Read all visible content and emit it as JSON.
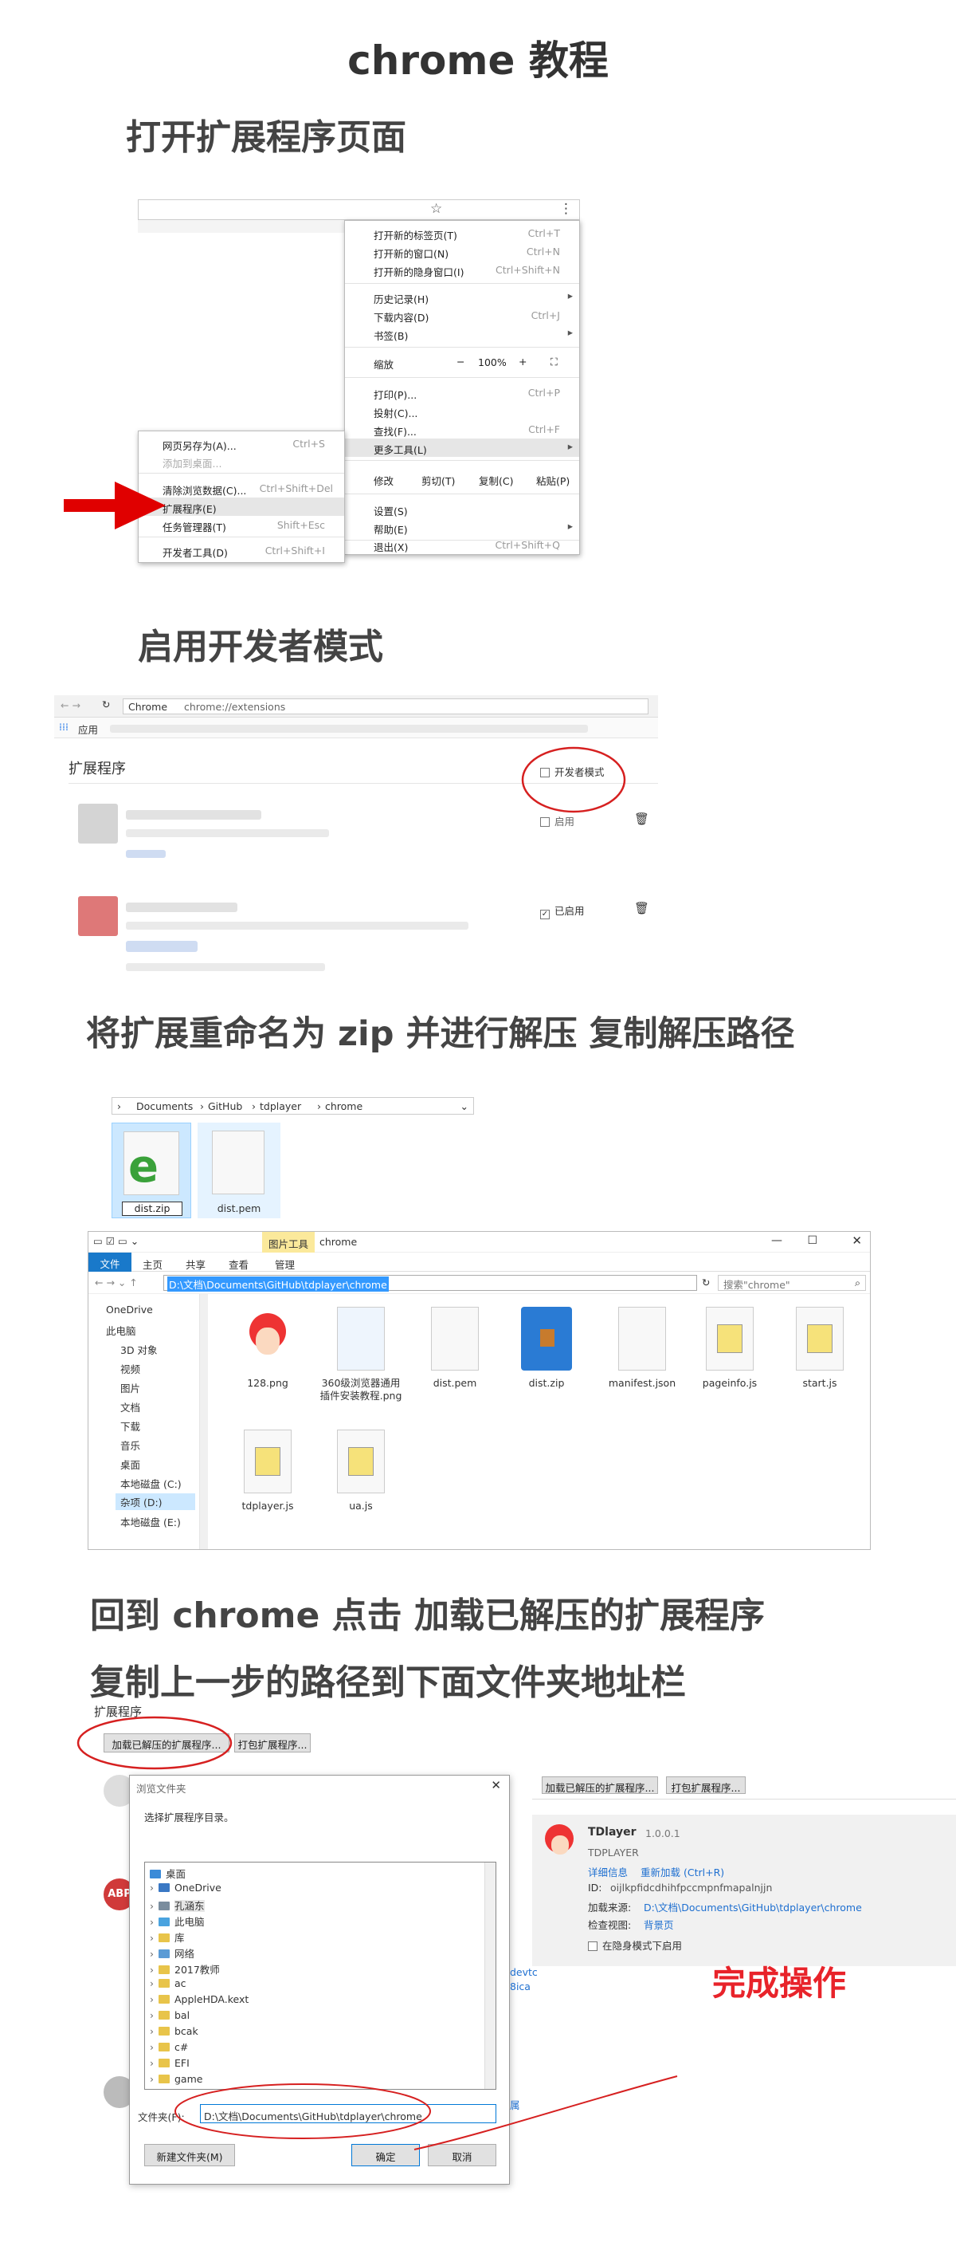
{
  "title": "chrome 教程",
  "steps": {
    "s1": "打开扩展程序页面",
    "s2": "启用开发者模式",
    "s3": "将扩展重命名为 zip 并进行解压 复制解压路径",
    "s4a": "回到 chrome 点击 加载已解压的扩展程序",
    "s4b": "复制上一步的路径到下面文件夹地址栏",
    "done": "完成操作"
  },
  "menu": {
    "items": [
      {
        "label": "打开新的标签页(T)",
        "key": "Ctrl+T"
      },
      {
        "label": "打开新的窗口(N)",
        "key": "Ctrl+N"
      },
      {
        "label": "打开新的隐身窗口(I)",
        "key": "Ctrl+Shift+N"
      },
      {
        "label": "历史记录(H)",
        "key": "▸"
      },
      {
        "label": "下载内容(D)",
        "key": "Ctrl+J"
      },
      {
        "label": "书签(B)",
        "key": "▸"
      },
      {
        "label": "打印(P)...",
        "key": "Ctrl+P"
      },
      {
        "label": "投射(C)...",
        "key": ""
      },
      {
        "label": "查找(F)...",
        "key": "Ctrl+F"
      },
      {
        "label": "更多工具(L)",
        "key": "▸"
      },
      {
        "label": "设置(S)",
        "key": ""
      },
      {
        "label": "帮助(E)",
        "key": "▸"
      },
      {
        "label": "退出(X)",
        "key": "Ctrl+Shift+Q"
      }
    ],
    "zoom": {
      "label": "缩放",
      "minus": "−",
      "value": "100%",
      "plus": "+",
      "full": "⛶"
    },
    "edit": {
      "label": "修改",
      "cut": "剪切(T)",
      "copy": "复制(C)",
      "paste": "粘贴(P)"
    },
    "sub": [
      {
        "label": "网页另存为(A)...",
        "key": "Ctrl+S"
      },
      {
        "label": "添加到桌面...",
        "key": ""
      },
      {
        "label": "清除浏览数据(C)...",
        "key": "Ctrl+Shift+Del"
      },
      {
        "label": "扩展程序(E)",
        "key": ""
      },
      {
        "label": "任务管理器(T)",
        "key": "Shift+Esc"
      },
      {
        "label": "开发者工具(D)",
        "key": "Ctrl+Shift+I"
      }
    ]
  },
  "ext": {
    "site": "Chrome",
    "url": "chrome://extensions",
    "apps": "应用",
    "heading": "扩展程序",
    "devmode": "开发者模式",
    "enable": "启用",
    "enabled": "已启用"
  },
  "rename": {
    "crumbs": [
      "Documents",
      "GitHub",
      "tdplayer",
      "chrome"
    ],
    "zip": "dist.zip",
    "pem": "dist.pem"
  },
  "explorer": {
    "ribbon_tool": "图片工具",
    "title": "chrome",
    "ribbon_manage": "管理",
    "tabs": [
      "文件",
      "主页",
      "共享",
      "查看"
    ],
    "path": "D:\\文档\\Documents\\GitHub\\tdplayer\\chrome",
    "search": "搜索\"chrome\"",
    "nav": [
      "OneDrive",
      "此电脑",
      "3D 对象",
      "视频",
      "图片",
      "文档",
      "下载",
      "音乐",
      "桌面",
      "本地磁盘 (C:)",
      "杂项 (D:)",
      "本地磁盘 (E:)"
    ],
    "files": [
      "128.png",
      "360级浏览器通用插件安装教程.png",
      "dist.pem",
      "dist.zip",
      "manifest.json",
      "pageinfo.js",
      "start.js",
      "tdplayer.js",
      "ua.js"
    ]
  },
  "load": {
    "heading": "扩展程序",
    "load_btn": "加载已解压的扩展程序...",
    "pack_btn": "打包扩展程序...",
    "dialog_title": "浏览文件夹",
    "prompt": "选择扩展程序目录。",
    "tree": [
      "桌面",
      "OneDrive",
      "孔涵东",
      "此电脑",
      "库",
      "网络",
      "2017教师",
      "ac",
      "AppleHDA.kext",
      "bal",
      "bcak",
      "c#",
      "EFI",
      "game"
    ],
    "folder_label": "文件夹(F):",
    "folder_value": "D:\\文档\\Documents\\GitHub\\tdplayer\\chrome",
    "new_folder": "新建文件夹(M)",
    "ok": "确定",
    "cancel": "取消"
  },
  "card": {
    "name": "TDlayer",
    "version": "1.0.0.1",
    "desc": "TDPLAYER",
    "details": "详细信息",
    "reload": "重新加载 (Ctrl+R)",
    "id_label": "ID:",
    "id": "oijlkpfidcdhihfpccmpnfmapalnjjn",
    "src_label": "加载来源:",
    "src": "D:\\文档\\Documents\\GitHub\\tdplayer\\chrome",
    "view_label": "检查视图:",
    "view": "背景页",
    "incog": "在隐身模式下启用"
  },
  "colors": {
    "red": "#e8232a",
    "blue": "#1e6fd0",
    "select": "#cce8ff"
  }
}
